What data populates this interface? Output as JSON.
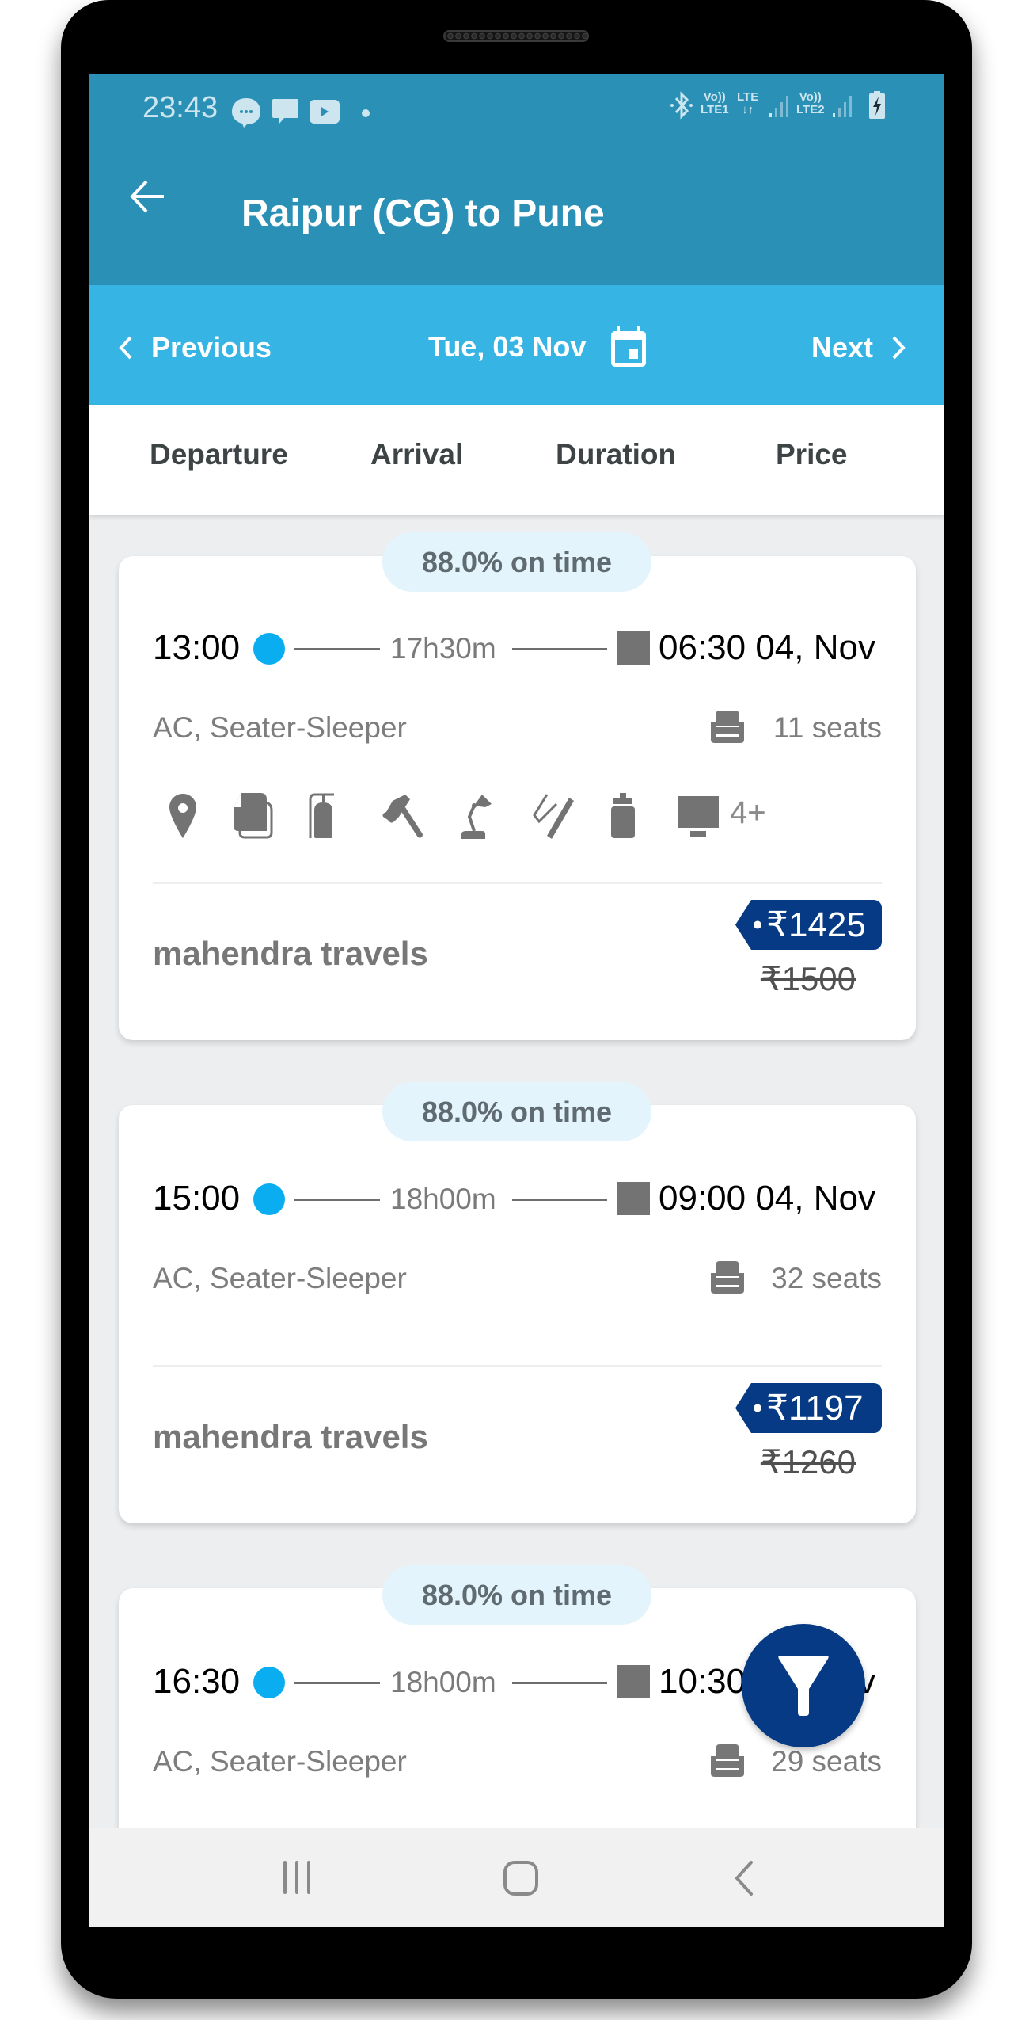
{
  "status_bar": {
    "time": "23:43",
    "left_icons": [
      "chat-bubble-icon",
      "message-icon",
      "youtube-icon",
      "notification-dot-icon"
    ],
    "right_icons": [
      "bluetooth-icon",
      "volte-lte1-icon",
      "lte-data-icon",
      "signal-1-icon",
      "volte-lte2-icon",
      "signal-2-icon",
      "battery-charging-icon"
    ],
    "volte1_top": "Vo))",
    "volte1_bottom": "LTE1",
    "lte_top": "LTE",
    "lte_bottom": "↓↑",
    "volte2_top": "Vo))",
    "volte2_bottom": "LTE2"
  },
  "header": {
    "back_icon": "arrow-left-icon",
    "title": "Raipur (CG) to Pune"
  },
  "date_bar": {
    "previous_label": "Previous",
    "date": "Tue, 03 Nov",
    "next_label": "Next",
    "calendar_icon": "calendar-icon"
  },
  "sort_tabs": [
    "Departure",
    "Arrival",
    "Duration",
    "Price"
  ],
  "results": [
    {
      "on_time": "88.0% on time",
      "departure": "13:00",
      "duration": "17h30m",
      "arrival": "06:30 04, Nov",
      "bus_type": "AC, Seater-Sleeper",
      "seats": "11 seats",
      "amenities": [
        "location-pin-icon",
        "blanket-icon",
        "fire-extinguisher-icon",
        "emergency-hammer-icon",
        "reading-lamp-icon",
        "charging-point-icon",
        "water-bottle-icon",
        "tv-icon"
      ],
      "more_amenities": "4+",
      "operator": "mahendra travels",
      "price": "₹1425",
      "original_price": "₹1500"
    },
    {
      "on_time": "88.0% on time",
      "departure": "15:00",
      "duration": "18h00m",
      "arrival": "09:00 04, Nov",
      "bus_type": "AC, Seater-Sleeper",
      "seats": "32 seats",
      "operator": "mahendra travels",
      "price": "₹1197",
      "original_price": "₹1260"
    },
    {
      "on_time": "88.0% on time",
      "departure": "16:30",
      "duration": "18h00m",
      "arrival": "10:30 04, Nov",
      "bus_type": "AC, Seater-Sleeper",
      "seats": "29 seats"
    }
  ],
  "fab": {
    "icon": "filter-icon"
  },
  "nav_bar": {
    "icons": [
      "recent-apps-icon",
      "home-icon",
      "back-icon"
    ]
  },
  "colors": {
    "header": "#2a90b5",
    "date_bar": "#36b4e4",
    "accent_dot": "#0aadef",
    "price_tag": "#063a84",
    "fab": "#063a84",
    "pill_bg": "#e4f4fc"
  }
}
